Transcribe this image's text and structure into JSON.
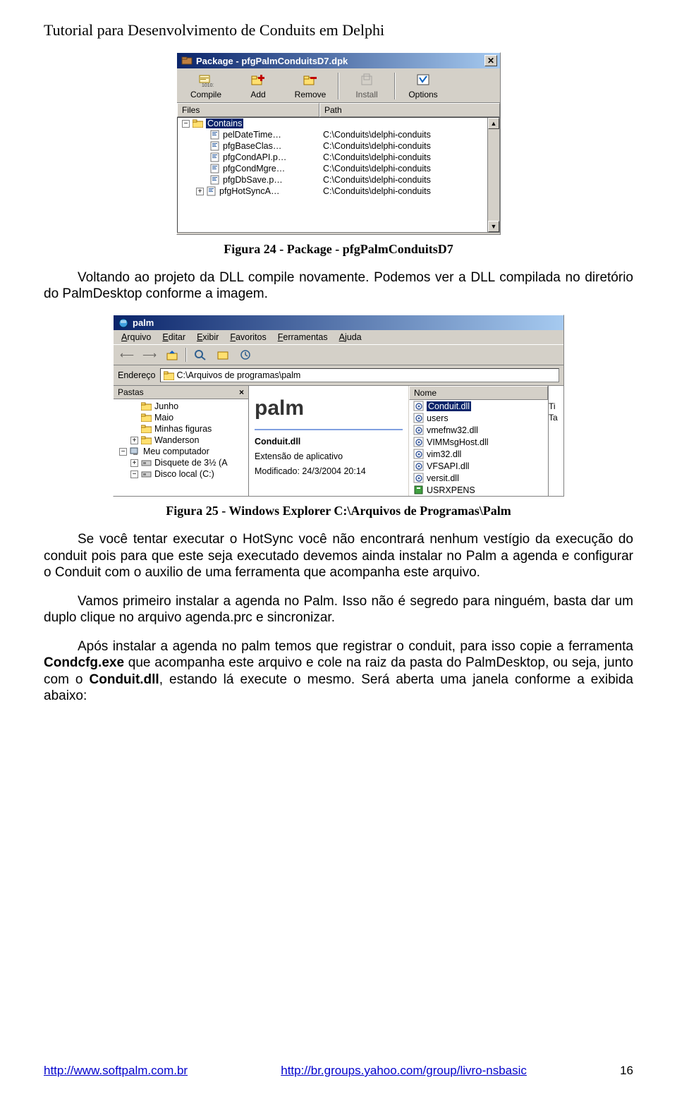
{
  "doc": {
    "header": "Tutorial para Desenvolvimento de Conduits em Delphi",
    "caption1": "Figura 24 - Package - pfgPalmConduitsD7",
    "para1": "Voltando ao projeto da DLL compile novamente. Podemos ver a DLL compilada no diretório do PalmDesktop conforme a imagem.",
    "caption2": "Figura 25 - Windows Explorer C:\\Arquivos de Programas\\Palm",
    "para2": "Se você tentar executar o HotSync você não encontrará nenhum vestígio da execução do conduit pois para que este seja executado devemos ainda instalar no Palm a agenda e configurar o Conduit com o auxilio de uma ferramenta que acompanha este arquivo.",
    "para3": "Vamos primeiro instalar a agenda no Palm. Isso não é segredo para ninguém, basta dar um duplo clique no arquivo agenda.prc e sincronizar.",
    "para4_a": "Após instalar a agenda no palm temos que registrar o conduit, para isso copie a ferramenta ",
    "para4_b": " que acompanha este arquivo e cole na raiz da pasta do PalmDesktop, ou seja, junto com o ",
    "para4_c": ", estando lá execute o mesmo. Será aberta uma janela conforme a exibida abaixo:",
    "bold1": "Condcfg.exe",
    "bold2": "Conduit.dll"
  },
  "footer": {
    "url1": "http://www.softpalm.com.br",
    "url2": "http://br.groups.yahoo.com/group/livro-nsbasic",
    "page": "16"
  },
  "pkg": {
    "title": "Package - pfgPalmConduitsD7.dpk",
    "toolbar": [
      "Compile",
      "Add",
      "Remove",
      "Install",
      "Options"
    ],
    "cols": [
      "Files",
      "Path"
    ],
    "root": "Contains",
    "files": [
      "pelDateTime…",
      "pfgBaseClas…",
      "pfgCondAPI.p…",
      "pfgCondMgre…",
      "pfgDbSave.p…",
      "pfgHotSyncA…"
    ],
    "paths": [
      "C:\\Conduits\\delphi-conduits",
      "C:\\Conduits\\delphi-conduits",
      "C:\\Conduits\\delphi-conduits",
      "C:\\Conduits\\delphi-conduits",
      "C:\\Conduits\\delphi-conduits",
      "C:\\Conduits\\delphi-conduits"
    ]
  },
  "exp": {
    "title": "palm",
    "menus": [
      "Arquivo",
      "Editar",
      "Exibir",
      "Favoritos",
      "Ferramentas",
      "Ajuda"
    ],
    "addr_label": "Endereço",
    "address": "C:\\Arquivos de programas\\palm",
    "left_title": "Pastas",
    "tree": [
      {
        "label": "Junho",
        "type": "folder",
        "indent": 1
      },
      {
        "label": "Maio",
        "type": "folder",
        "indent": 1
      },
      {
        "label": "Minhas figuras",
        "type": "folder",
        "indent": 1
      },
      {
        "label": "Wanderson",
        "type": "folder",
        "indent": 1,
        "expand": "+"
      },
      {
        "label": "Meu computador",
        "type": "computer",
        "indent": 0,
        "expand": "-"
      },
      {
        "label": "Disquete de 3½ (A",
        "type": "drive",
        "indent": 1,
        "expand": "+"
      },
      {
        "label": "Disco local (C:)",
        "type": "drive",
        "indent": 1,
        "expand": "-"
      }
    ],
    "mid": {
      "logo": "palm",
      "name": "Conduit.dll",
      "kind": "Extensão de aplicativo",
      "mod": "Modificado: 24/3/2004 20:14"
    },
    "right_head": [
      "Nome"
    ],
    "right_side": "Ti\nTa",
    "files": [
      {
        "name": "Conduit.dll",
        "icon": "gear",
        "selected": true
      },
      {
        "name": "users",
        "icon": "gear"
      },
      {
        "name": "vmefnw32.dll",
        "icon": "gear"
      },
      {
        "name": "VIMMsgHost.dll",
        "icon": "gear"
      },
      {
        "name": "vim32.dll",
        "icon": "gear"
      },
      {
        "name": "VFSAPI.dll",
        "icon": "gear"
      },
      {
        "name": "versit.dll",
        "icon": "gear"
      },
      {
        "name": "USRXPENS",
        "icon": "palm"
      }
    ]
  }
}
